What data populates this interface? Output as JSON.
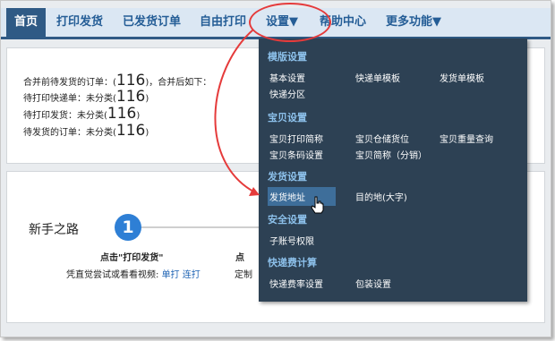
{
  "nav": {
    "home": "首页",
    "print_ship": "打印发货",
    "shipped_orders": "已发货订单",
    "free_print": "自由打印",
    "settings": "设置▼",
    "help_center": "帮助中心",
    "more": "更多功能▼"
  },
  "stats": {
    "line1_prefix": "合并前待发货的订单：(",
    "line1_count": "116",
    "line1_suffix": ")，合并后如下：",
    "line2_prefix": "待打印快递单：未分类(",
    "line2_count": "116",
    "line3_prefix": "待打印发货：未分类(",
    "line3_count": "116",
    "line4_prefix": "待发货的订单：未分类(",
    "line4_count": "116",
    "close_paren": ")"
  },
  "guide": {
    "title": "新手之路",
    "step_number": "1",
    "step1_title": "点击\"打印发货\"",
    "step1_desc": "凭直觉尝试或看看视频:",
    "step1_link1": "单打",
    "step1_link2": "连打",
    "step2_title_fragment": "点",
    "step2_desc_fragment": "定制"
  },
  "menu": {
    "template_section": "模版设置",
    "basic_settings": "基本设置",
    "express_template": "快递单模板",
    "ship_template": "发货单模板",
    "express_zone": "快递分区",
    "product_section": "宝贝设置",
    "product_print_name": "宝贝打印简称",
    "product_warehouse": "宝贝仓储货位",
    "product_weight_query": "宝贝重量查询",
    "product_barcode": "宝贝条码设置",
    "product_short_name": "宝贝简称（分销）",
    "ship_section": "发货设置",
    "ship_address": "发货地址",
    "destination": "目的地(大字)",
    "security_section": "安全设置",
    "sub_account": "子账号权限",
    "freight_section": "快递费计算",
    "freight_rate": "快递费率设置",
    "packaging": "包装设置"
  },
  "colors": {
    "nav_bg": "#dbe7f3",
    "nav_accent": "#2f5a85",
    "menu_bg": "#2d4154",
    "menu_section": "#8cc0ea",
    "annotation": "#e53b3b"
  }
}
